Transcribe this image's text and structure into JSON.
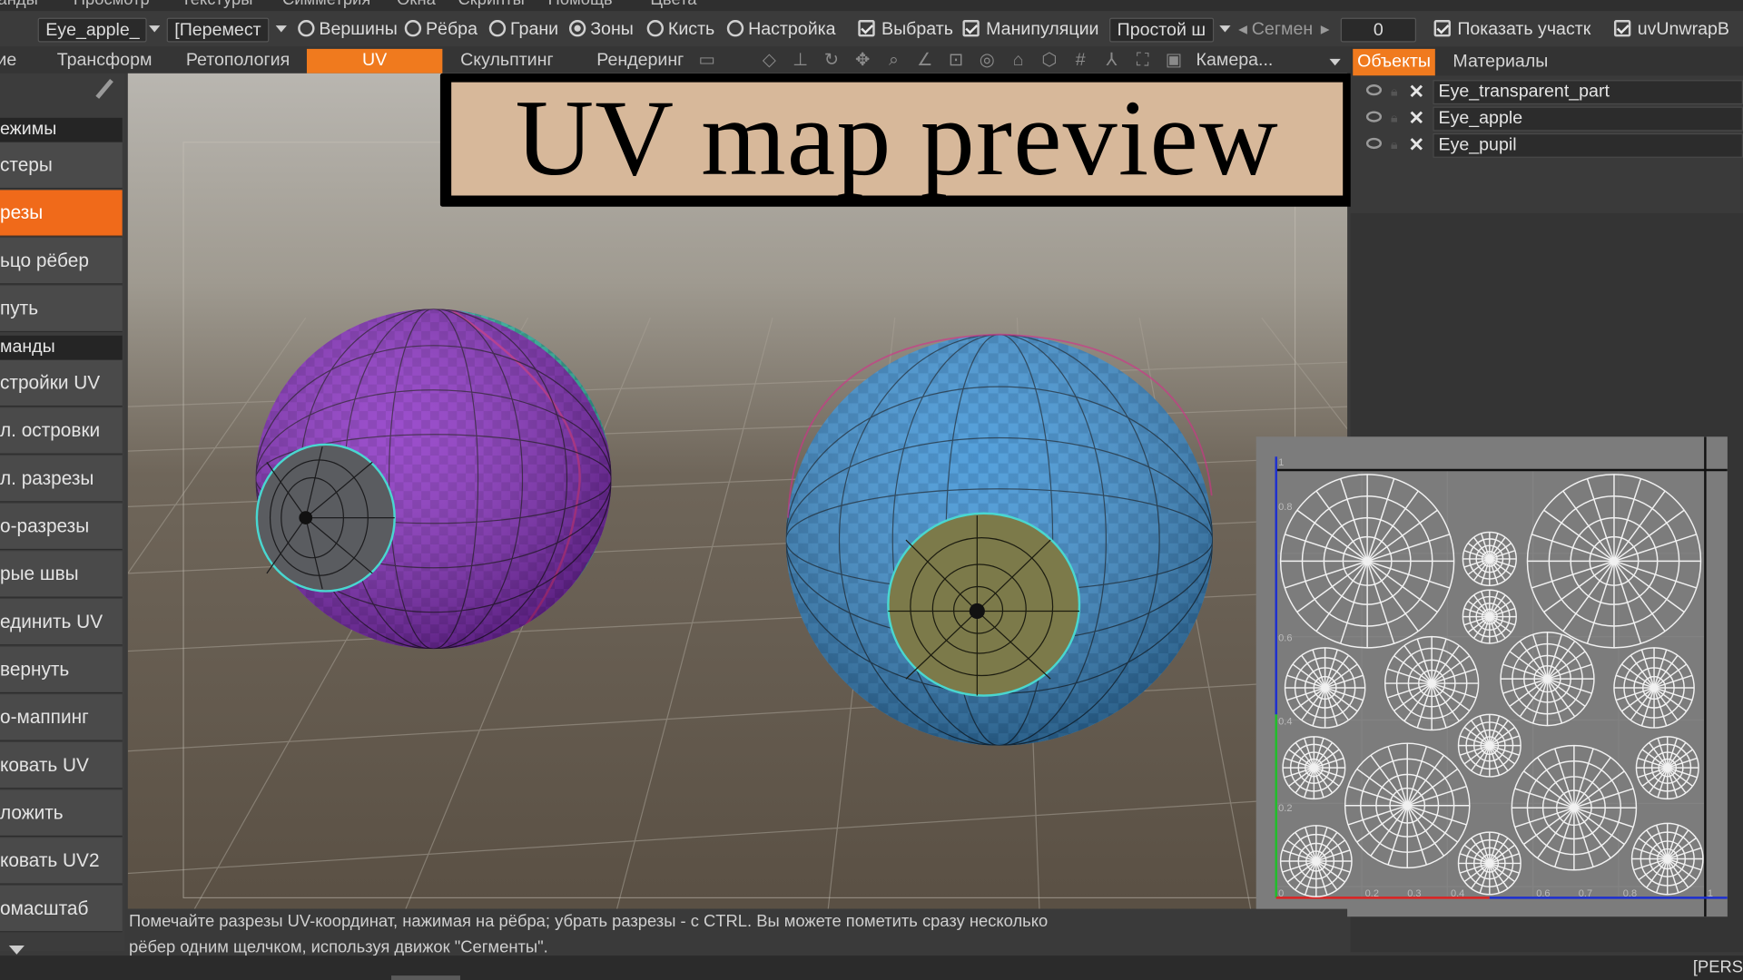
{
  "menubar": [
    "анды",
    "Просмотр",
    "Текстуры",
    "Симметрия",
    "Окна",
    "Скрипты",
    "Помощь",
    "Цвета"
  ],
  "toolbar": {
    "object_select": "Eye_apple_",
    "tool_select": "[Перемест",
    "modes": [
      {
        "label": "Вершины",
        "on": false
      },
      {
        "label": "Рёбра",
        "on": false
      },
      {
        "label": "Грани",
        "on": false
      },
      {
        "label": "Зоны",
        "on": true
      },
      {
        "label": "Кисть",
        "on": false
      },
      {
        "label": "Настройка",
        "on": false
      }
    ],
    "check_select": "Выбрать",
    "check_manip": "Манипуляции",
    "mode_select": "Простой ш",
    "segments_label": "Сегмен",
    "segments_value": "0",
    "show_label": "Показать участк",
    "uvunwrap_label": "uvUnwrapB"
  },
  "tabs": {
    "items": [
      "ие",
      "Трансформ",
      "Ретопология",
      "UV",
      "Скульптинг",
      "Рендеринг"
    ],
    "active": "UV",
    "camera_label": "Камера..."
  },
  "left_panel": {
    "section_modes": "ежимы",
    "section_commands": "манды",
    "modes": [
      "стеры",
      "резы",
      "ьцо рёбер",
      "путь"
    ],
    "active_mode": "резы",
    "commands": [
      "стройки UV",
      "л. островки",
      "л. разрезы",
      "о-разрезы",
      "рые швы",
      "единить UV",
      "вернуть",
      "о-маппинг",
      "ковать UV",
      "ложить",
      "ковать UV2",
      "омасштаб"
    ]
  },
  "title_overlay": "UV map preview",
  "right_panel": {
    "tab_objects": "Объекты",
    "tab_materials": "Материалы",
    "objects": [
      "Eye_transparent_part",
      "Eye_apple",
      "Eye_pupil"
    ]
  },
  "uv_preview": {
    "y_ticks": [
      "1",
      "0.8",
      "0.6",
      "0.4",
      "0.2",
      "0"
    ],
    "x_ticks": [
      "0.2",
      "0.3",
      "0.4",
      "0.6",
      "0.7",
      "0.8",
      "1"
    ]
  },
  "status": {
    "line1": "Помечайте разрезы UV-координат, нажимая на рёбра; убрать разрезы - с CTRL. Вы можете пометить сразу несколько",
    "line2": "рёбер одним щелчком, используя движок \"Сегменты\"."
  },
  "bottom_right": "[PERS",
  "colors": {
    "accent": "#f07a1e",
    "eye_left_purple": "#8a2fc4",
    "eye_left_teal": "#35c9b0",
    "eye_right_blue": "#3d93d6",
    "eye_right_iris": "#7c7a4a",
    "title_bg": "#d7b89a"
  }
}
